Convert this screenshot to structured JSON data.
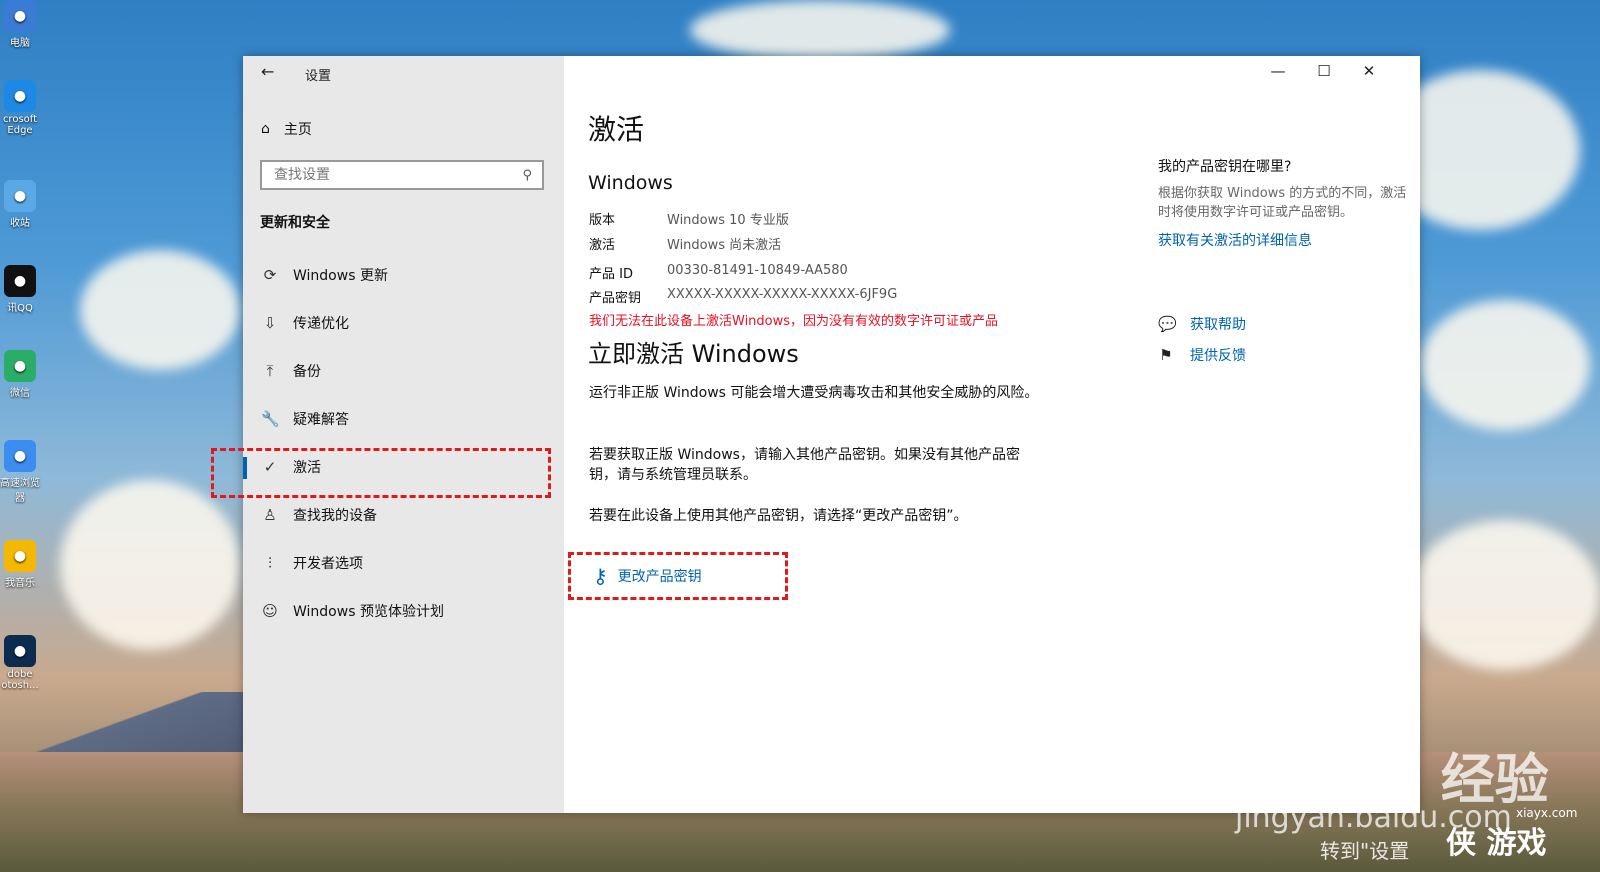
{
  "desktop_icons": [
    {
      "label": "电脑",
      "icon": "computer-icon",
      "color": "#3a7bd5"
    },
    {
      "label": "crosoft Edge",
      "icon": "edge-icon",
      "color": "#1e88e5"
    },
    {
      "label": "收站",
      "icon": "recycle-bin-icon",
      "color": "#5aa9e6"
    },
    {
      "label": "讯QQ",
      "icon": "qq-icon",
      "color": "#111111"
    },
    {
      "label": "微信",
      "icon": "wechat-icon",
      "color": "#2aae67"
    },
    {
      "label": "高速浏览器",
      "icon": "browser-icon",
      "color": "#3b8ef0"
    },
    {
      "label": "我音乐",
      "icon": "music-icon",
      "color": "#f5b800"
    },
    {
      "label": "dobe otosh...",
      "icon": "photoshop-icon",
      "color": "#0b2b4f"
    }
  ],
  "window": {
    "title": "设置",
    "controls": {
      "minimize": "—",
      "maximize": "☐",
      "close": "✕"
    }
  },
  "sidebar": {
    "home": "主页",
    "search_placeholder": "查找设置",
    "section": "更新和安全",
    "items": [
      {
        "label": "Windows 更新",
        "icon": "refresh-icon",
        "glyph": "⟳"
      },
      {
        "label": "传递优化",
        "icon": "delivery-icon",
        "glyph": "⇩"
      },
      {
        "label": "备份",
        "icon": "backup-icon",
        "glyph": "⤒"
      },
      {
        "label": "疑难解答",
        "icon": "wrench-icon",
        "glyph": "🔧"
      },
      {
        "label": "激活",
        "icon": "check-circle-icon",
        "glyph": "✓",
        "active": true
      },
      {
        "label": "查找我的设备",
        "icon": "person-pin-icon",
        "glyph": "♙"
      },
      {
        "label": "开发者选项",
        "icon": "developer-icon",
        "glyph": "⫶"
      },
      {
        "label": "Windows 预览体验计划",
        "icon": "insider-icon",
        "glyph": "☺"
      }
    ]
  },
  "main": {
    "title": "激活",
    "subtitle": "Windows",
    "info": [
      {
        "key": "版本",
        "value": "Windows 10 专业版"
      },
      {
        "key": "激活",
        "value": "Windows 尚未激活"
      },
      {
        "key": "产品 ID",
        "value": "00330-81491-10849-AA580"
      },
      {
        "key": "产品密钥",
        "value": "XXXXX-XXXXX-XXXXX-XXXXX-6JF9G"
      }
    ],
    "error": "我们无法在此设备上激活Windows，因为没有有效的数字许可证或产品",
    "activate_title": "立即激活 Windows",
    "para1": "运行非正版 Windows 可能会增大遭受病毒攻击和其他安全威胁的风险。",
    "para2": "若要获取正版 Windows，请输入其他产品密钥。如果没有其他产品密钥，请与系统管理员联系。",
    "para3": "若要在此设备上使用其他产品密钥，请选择“更改产品密钥”。",
    "change_key": "更改产品密钥"
  },
  "right": {
    "heading": "我的产品密钥在哪里?",
    "text": "根据你获取 Windows 的方式的不同，激活时将使用数字许可证或产品密钥。",
    "link": "获取有关激活的详细信息",
    "help": "获取帮助",
    "feedback": "提供反馈"
  },
  "watermark": {
    "baidu": "Bai du 经验",
    "url": "jingyan.baidu.com",
    "caption": "转到\"设置",
    "site": "xiayx.com",
    "brand": "侠 游戏"
  }
}
